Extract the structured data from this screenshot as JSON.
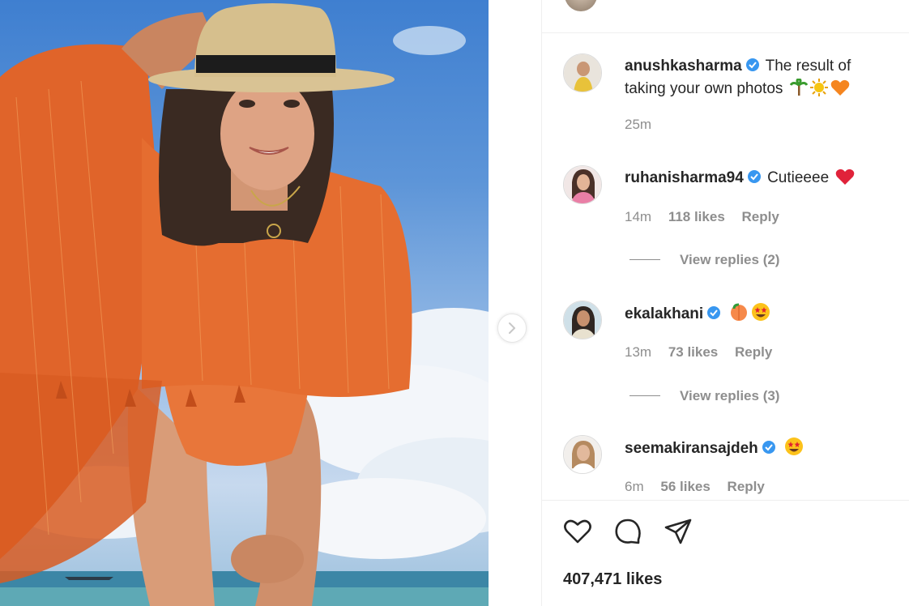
{
  "post": {
    "caption": {
      "username": "anushkasharma",
      "text": "The result of taking your own photos",
      "emojis": [
        "palm-tree-emoji",
        "sun-emoji",
        "orange-heart-emoji"
      ],
      "time": "25m"
    },
    "comments": [
      {
        "username": "ruhanisharma94",
        "text": "Cutieeee",
        "emojis": [
          "red-heart-emoji"
        ],
        "time": "14m",
        "likes": "118 likes",
        "reply": "Reply",
        "view_replies": "View replies (2)"
      },
      {
        "username": "ekalakhani",
        "text": "",
        "emojis": [
          "peach-emoji",
          "star-struck-emoji"
        ],
        "time": "13m",
        "likes": "73 likes",
        "reply": "Reply",
        "view_replies": "View replies (3)"
      },
      {
        "username": "seemakiransajdeh",
        "text": "",
        "emojis": [
          "star-struck-emoji"
        ],
        "time": "6m",
        "likes": "56 likes",
        "reply": "Reply"
      }
    ],
    "like_count": "407,471 likes"
  },
  "colors": {
    "verified": "#3897f0",
    "text": "#262626",
    "muted": "#8e8e8e",
    "sky": "#4f8bd6",
    "scarf": "#e0642a"
  },
  "icons": [
    "heart-icon",
    "comment-icon",
    "share-icon",
    "chevron-right-icon"
  ]
}
